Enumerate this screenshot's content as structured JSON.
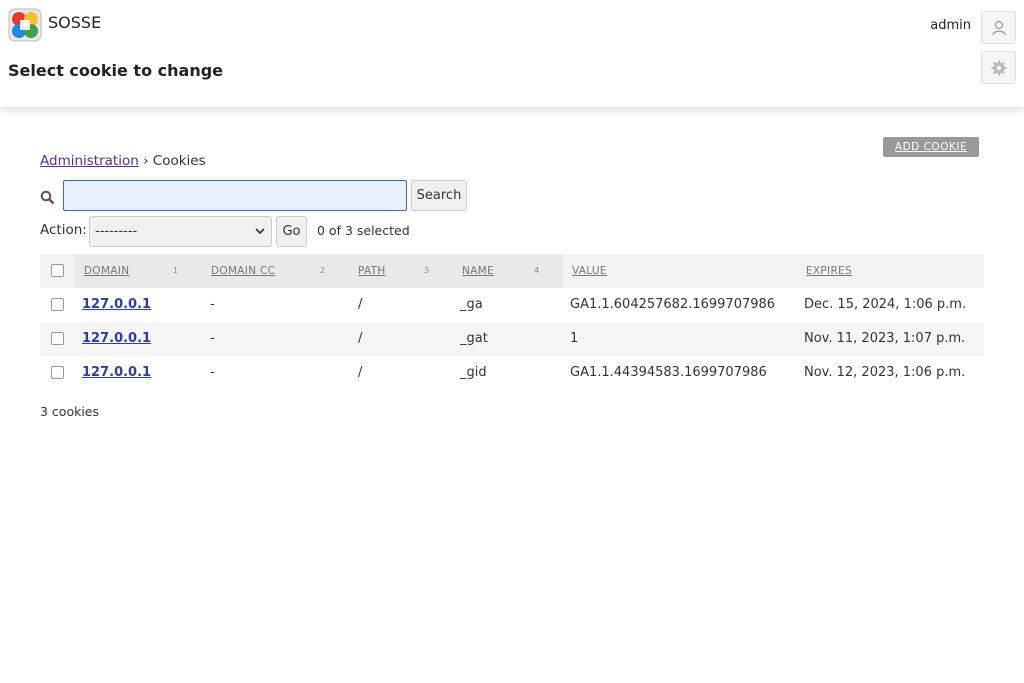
{
  "header": {
    "brand": "SOSSE",
    "title": "Select cookie to change",
    "user": "admin"
  },
  "toolbar": {
    "add_label": "ADD COOKIE"
  },
  "breadcrumb": {
    "root": "Administration",
    "separator": "›",
    "current": "Cookies"
  },
  "search": {
    "placeholder": "",
    "value": "",
    "button_label": "Search"
  },
  "actions": {
    "label": "Action:",
    "selected_option": "---------",
    "go_label": "Go",
    "selected_text": "0 of 3 selected"
  },
  "table": {
    "columns": [
      {
        "label": "DOMAIN",
        "sort": "1"
      },
      {
        "label": "DOMAIN CC",
        "sort": "2"
      },
      {
        "label": "PATH",
        "sort": "3"
      },
      {
        "label": "NAME",
        "sort": "4"
      },
      {
        "label": "VALUE",
        "sort": ""
      },
      {
        "label": "EXPIRES",
        "sort": ""
      }
    ],
    "rows": [
      {
        "domain": "127.0.0.1",
        "domain_cc": "-",
        "path": "/",
        "name": "_ga",
        "value": "GA1.1.604257682.1699707986",
        "expires": "Dec. 15, 2024, 1:06 p.m."
      },
      {
        "domain": "127.0.0.1",
        "domain_cc": "-",
        "path": "/",
        "name": "_gat",
        "value": "1",
        "expires": "Nov. 11, 2023, 1:07 p.m."
      },
      {
        "domain": "127.0.0.1",
        "domain_cc": "-",
        "path": "/",
        "name": "_gid",
        "value": "GA1.1.44394583.1699707986",
        "expires": "Nov. 12, 2023, 1:06 p.m."
      }
    ]
  },
  "footer": {
    "count": "3 cookies"
  },
  "colors": {
    "link": "#5b2e91",
    "row_link": "#2a3ea3",
    "input_focus": "#3b6ea5"
  }
}
